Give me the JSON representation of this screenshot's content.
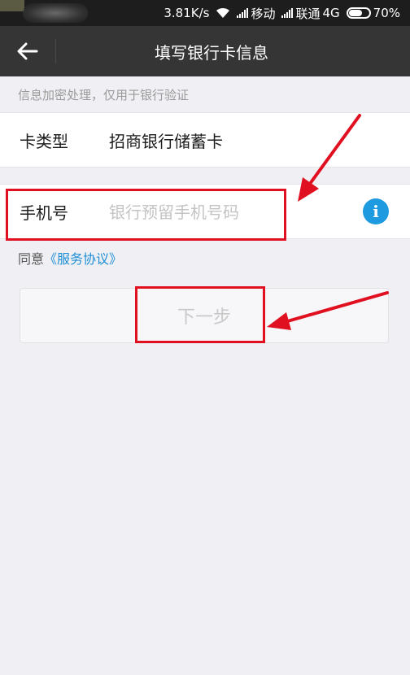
{
  "status_bar": {
    "speed": "3.81K/s",
    "carrier1": "移动",
    "carrier2": "联通",
    "network": "4G",
    "battery_percent": "70%",
    "battery_level": 0.7
  },
  "header": {
    "back_icon": "arrow-left-icon",
    "title": "填写银行卡信息"
  },
  "hint": "信息加密处理，仅用于银行验证",
  "card_type": {
    "label": "卡类型",
    "value": "招商银行储蓄卡"
  },
  "phone": {
    "label": "手机号",
    "value": "",
    "placeholder": "银行预留手机号码",
    "info_icon": "info-icon"
  },
  "agreement": {
    "prefix": "同意",
    "link": "《服务协议》"
  },
  "next_button": {
    "label": "下一步"
  },
  "colors": {
    "title_bar": "#353535",
    "status_bar": "#1d1d1d",
    "accent_blue": "#1e9ae0",
    "annotation_red": "#e01020",
    "background": "#f0f0f4"
  }
}
